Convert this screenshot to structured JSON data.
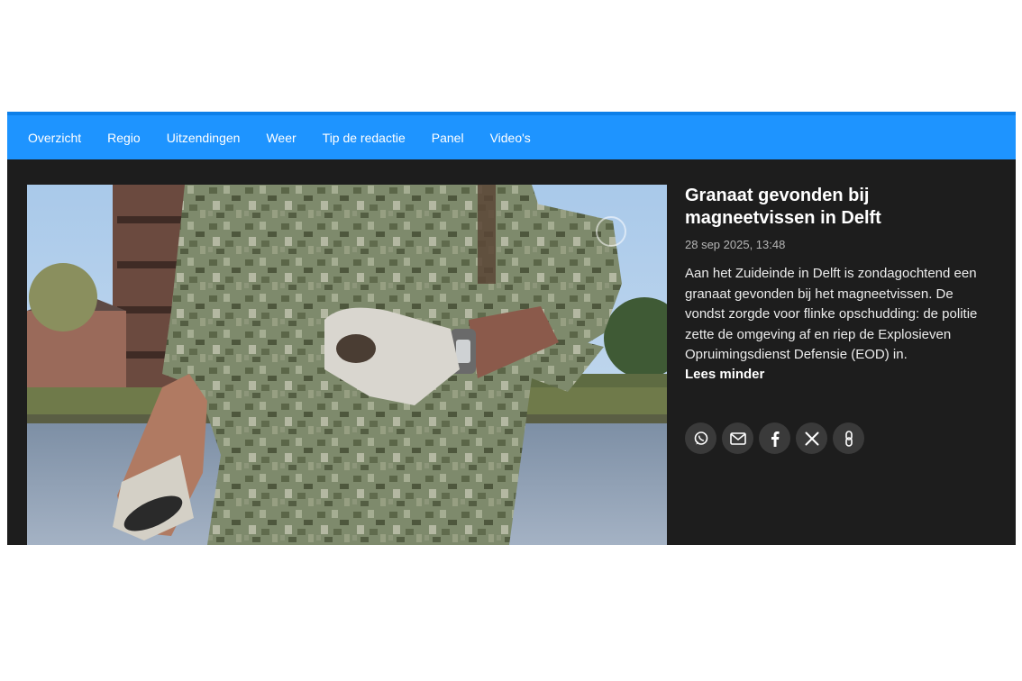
{
  "nav": {
    "items": [
      {
        "label": "Overzicht"
      },
      {
        "label": "Regio"
      },
      {
        "label": "Uitzendingen"
      },
      {
        "label": "Weer"
      },
      {
        "label": "Tip de redactie"
      },
      {
        "label": "Panel"
      },
      {
        "label": "Video's"
      }
    ],
    "color": "#1e94ff"
  },
  "article": {
    "headline": "Granaat gevonden bij magneetvissen in Delft",
    "timestamp": "28 sep 2025, 13:48",
    "body": "Aan het Zuideinde in Delft is zondagochtend een granaat gevonden bij het magneetvissen. De vondst zorgde voor flinke opschudding: de politie zette de omgeving af en riep de Explosieven Opruimingsdienst Defensie (EOD) in.",
    "read_less_label": "Lees minder"
  },
  "share": {
    "icons": [
      "whatsapp-icon",
      "email-icon",
      "facebook-icon",
      "x-icon",
      "link-icon"
    ]
  },
  "colors": {
    "panel_background": "#1d1d1d",
    "share_button": "#3a3a3a"
  }
}
